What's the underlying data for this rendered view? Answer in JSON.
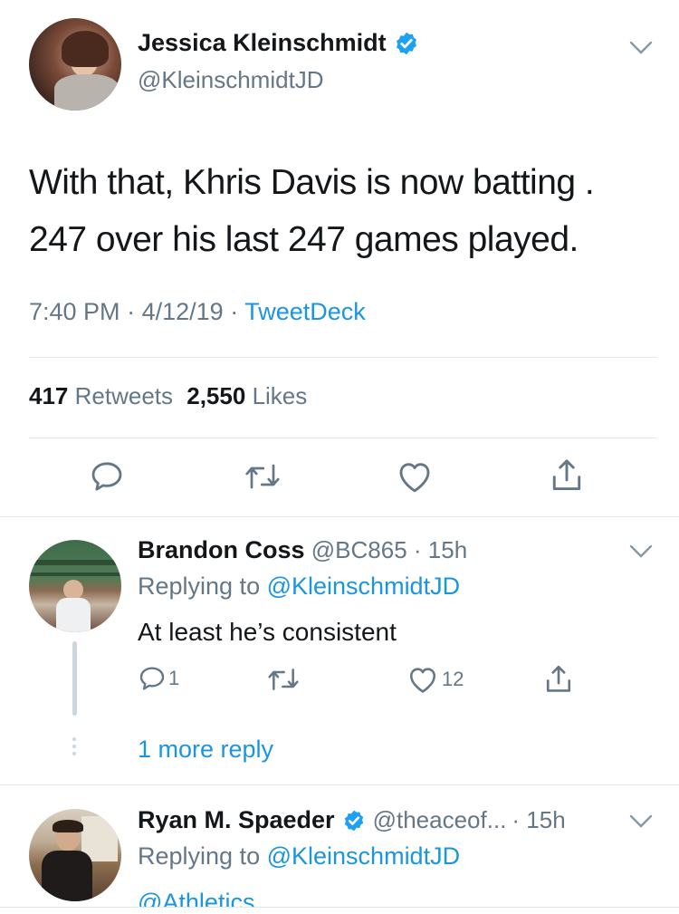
{
  "main_tweet": {
    "author_name": "Jessica Kleinschmidt",
    "author_handle": "@KleinschmidtJD",
    "text_line1": "With that, Khris Davis is now batting .",
    "text_line2": "247 over his last 247 games played.",
    "time": "7:40 PM",
    "date": "4/12/19",
    "separator": "·",
    "source": "TweetDeck",
    "retweet_count": "417",
    "retweet_label": "Retweets",
    "like_count": "2,550",
    "like_label": "Likes"
  },
  "replies": [
    {
      "author_name": "Brandon Coss",
      "author_handle": "@BC865",
      "age": "· 15h",
      "replying_prefix": "Replying to",
      "replying_to": "@KleinschmidtJD",
      "text": "At least he’s consistent",
      "reply_count": "1",
      "like_count": "12",
      "more_replies": "1 more reply"
    },
    {
      "author_name": "Ryan M. Spaeder",
      "author_handle": "@theaceof...",
      "age": "· 15h",
      "replying_prefix": "Replying to",
      "replying_to": "@KleinschmidtJD",
      "text": "@Athletics"
    }
  ],
  "colors": {
    "accent": "#1b95e0",
    "text": "#14171a",
    "muted": "#657786",
    "divider": "#e1e8ed",
    "verified": "#1da1f2"
  },
  "icons": [
    "chevron-down-icon",
    "verified-icon",
    "reply-icon",
    "retweet-icon",
    "like-icon",
    "share-icon"
  ]
}
